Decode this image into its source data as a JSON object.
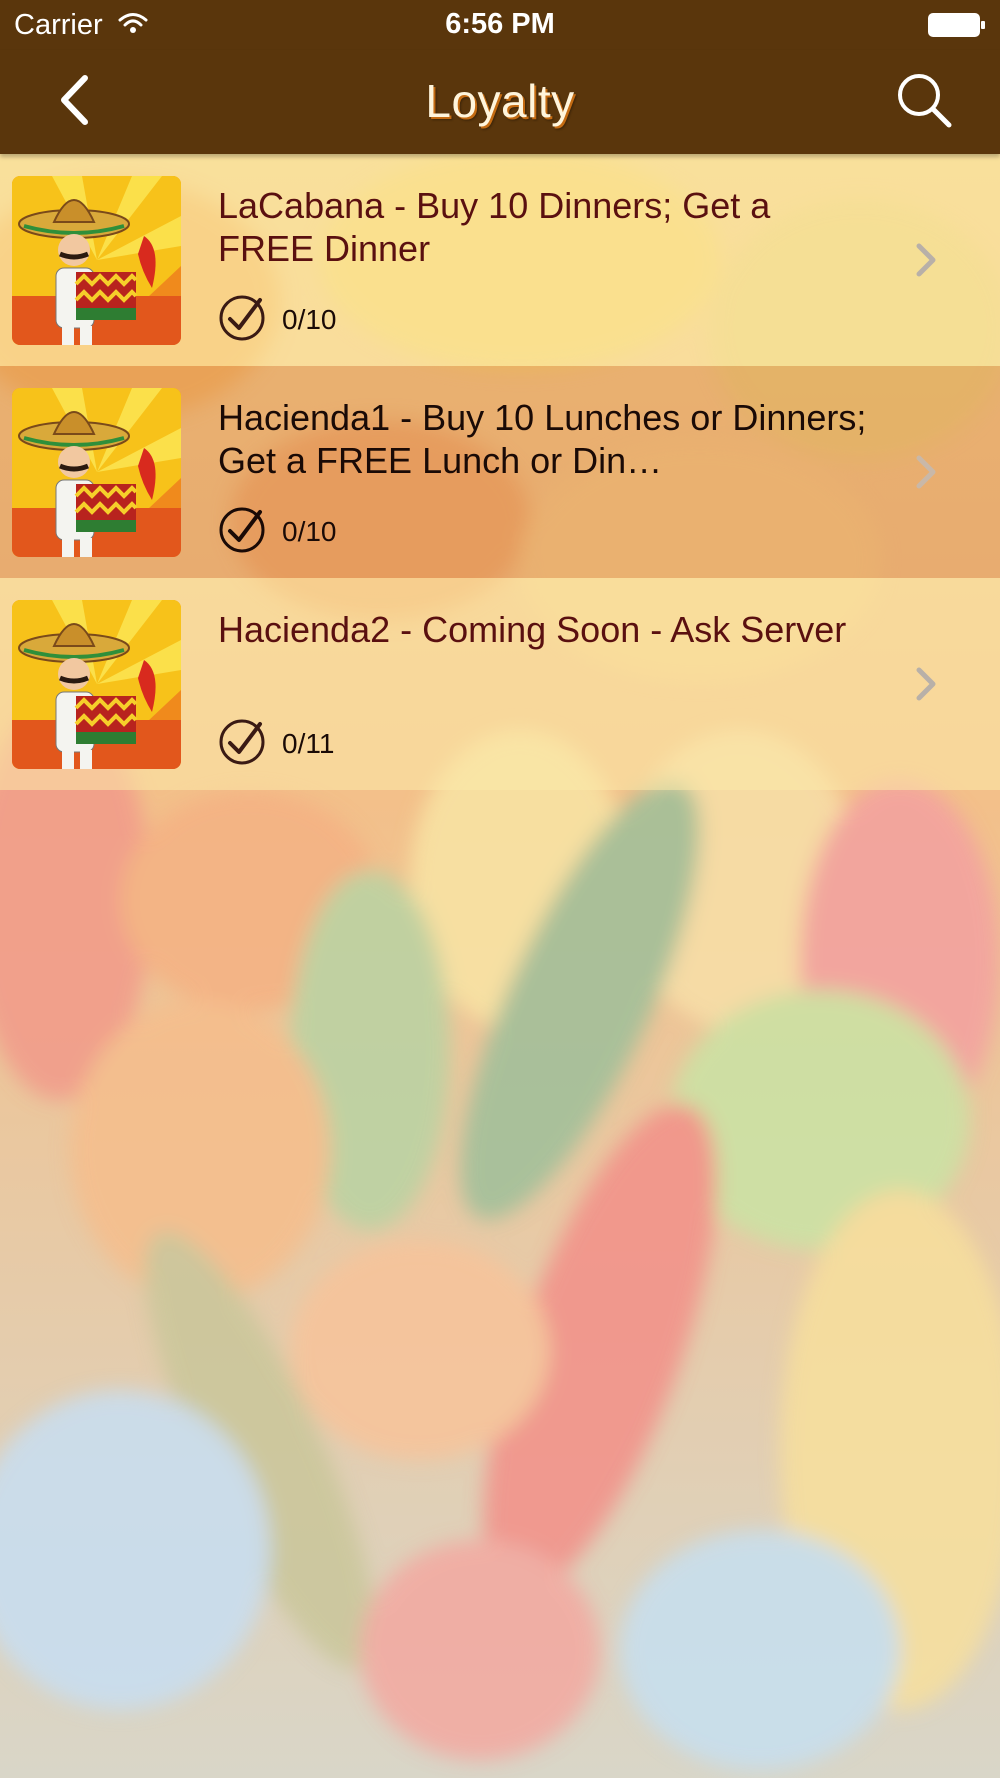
{
  "status_bar": {
    "carrier": "Carrier",
    "time": "6:56 PM"
  },
  "nav": {
    "title": "Loyalty",
    "back_icon": "chevron-left-icon",
    "search_icon": "search-icon"
  },
  "colors": {
    "bar": "#5a360c",
    "title_text": "#fff5dc",
    "title_shadow": "#c46b12",
    "row_title_brown": "#5a1010"
  },
  "loyalty_items": [
    {
      "title": "LaCabana - Buy 10 Dinners; Get a FREE Dinner",
      "progress": "0/10"
    },
    {
      "title": "Hacienda1 - Buy 10 Lunches or Dinners; Get a FREE Lunch or Din…",
      "progress": "0/10"
    },
    {
      "title": "Hacienda2 - Coming Soon - Ask Server",
      "progress": "0/11"
    }
  ]
}
